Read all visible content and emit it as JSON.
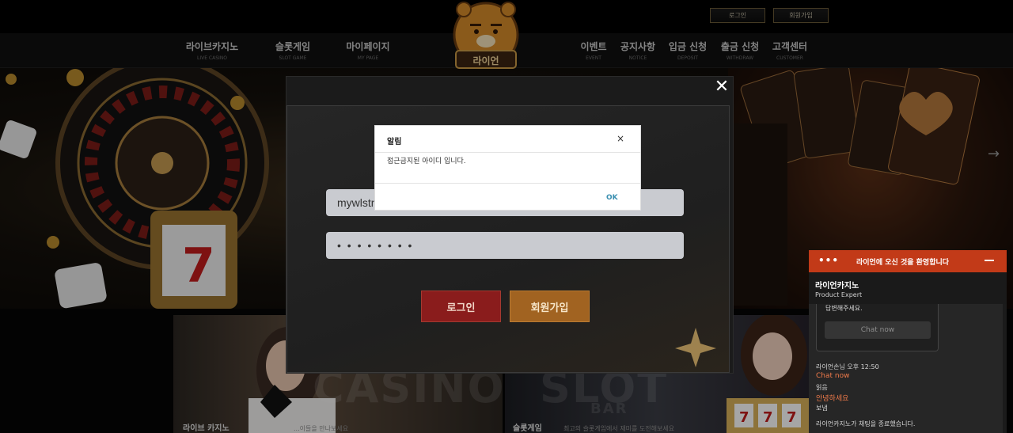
{
  "header": {
    "login_label": "로그인",
    "signup_label": "회원가입",
    "logo_text": "라이언"
  },
  "nav": {
    "left": [
      {
        "label": "라이브카지노",
        "sub": "LIVE CASINO"
      },
      {
        "label": "슬롯게임",
        "sub": "SLOT GAME"
      },
      {
        "label": "마이페이지",
        "sub": "MY PAGE"
      }
    ],
    "right": [
      {
        "label": "이벤트",
        "sub": "EVENT"
      },
      {
        "label": "공지사항",
        "sub": "NOTICE"
      },
      {
        "label": "입금 신청",
        "sub": "DEPOSIT"
      },
      {
        "label": "출금 신청",
        "sub": "WITHDRAW"
      },
      {
        "label": "고객센터",
        "sub": "CUSTOMER"
      }
    ]
  },
  "banner": {
    "next_arrow": "→"
  },
  "promos": {
    "casino": {
      "big": "CASINO",
      "title": "라이브 카지노",
      "desc": "...이들을 만나보세요"
    },
    "slot": {
      "big": "SLOT",
      "title": "슬롯게임",
      "desc": "최고의 슬롯게임에서 재미를 도전해보세요",
      "bar": "BAR"
    }
  },
  "login_modal": {
    "close": "✕",
    "username_value": "mywlstm",
    "password_mask": "• • • • • • • •",
    "login_button": "로그인",
    "signup_button": "회원가입"
  },
  "alert": {
    "title": "알림",
    "close": "×",
    "message": "접근금지된 아이디 입니다.",
    "ok": "OK"
  },
  "chat": {
    "dots": "•••",
    "title": "라이언에 오신 것을 환영합니다",
    "agent_name": "라이언카지노",
    "agent_role": "Product Expert",
    "bubble_text": "답변해주세요.",
    "chat_now_button": "Chat now",
    "messages": [
      {
        "text": "라이언손님 오후 12:50",
        "accent": false
      },
      {
        "text": "Chat now",
        "accent": true
      },
      {
        "text": "읽음",
        "accent": false
      },
      {
        "text": "안녕하세요",
        "accent": true
      },
      {
        "text": "보냄",
        "accent": false
      },
      {
        "text": "라이언카지노가 채팅을 종료했습니다.",
        "accent": false
      }
    ]
  },
  "colors": {
    "chat_header": "#c23a18",
    "login_button": "#8a1c1c",
    "signup_button": "#a16321",
    "ok_link": "#3a8fb0"
  }
}
